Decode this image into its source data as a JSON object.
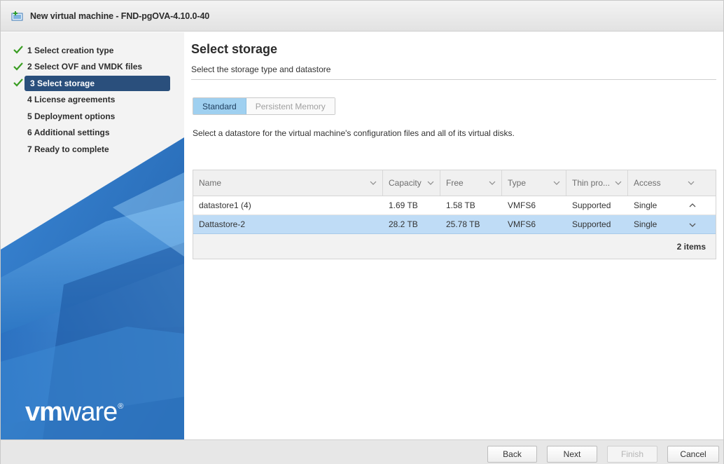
{
  "window": {
    "title": "New virtual machine - FND-pgOVA-4.10.0-40",
    "title_icon": "new-vm-icon"
  },
  "wizard": {
    "steps": [
      {
        "label": "1 Select creation type",
        "done": true
      },
      {
        "label": "2 Select OVF and VMDK files",
        "done": true
      },
      {
        "label": "3 Select storage",
        "done": true,
        "active": true
      },
      {
        "label": "4 License agreements",
        "done": false
      },
      {
        "label": "5 Deployment options",
        "done": false
      },
      {
        "label": "6 Additional settings",
        "done": false
      },
      {
        "label": "7 Ready to complete",
        "done": false
      }
    ],
    "check_color": "#3a9d23",
    "active_color": "#2a4f7c"
  },
  "brand": {
    "logo_bold": "vm",
    "logo_rest": "ware",
    "logo_mark": "®"
  },
  "page": {
    "title": "Select storage",
    "subtitle": "Select the storage type and datastore",
    "tabs": [
      {
        "label": "Standard",
        "selected": true
      },
      {
        "label": "Persistent Memory",
        "selected": false
      }
    ],
    "instruction": "Select a datastore for the virtual machine's configuration files and all of its virtual disks."
  },
  "datastores": {
    "columns": [
      "Name",
      "Capacity",
      "Free",
      "Type",
      "Thin pro...",
      "Access"
    ],
    "rows": [
      {
        "name": "datastore1 (4)",
        "capacity": "1.69 TB",
        "free": "1.58 TB",
        "type": "VMFS6",
        "thin": "Supported",
        "access": "Single",
        "selected": false
      },
      {
        "name": "Dattastore-2",
        "capacity": "28.2 TB",
        "free": "25.78 TB",
        "type": "VMFS6",
        "thin": "Supported",
        "access": "Single",
        "selected": true
      }
    ],
    "item_count": "2 items",
    "selected_row_color": "#bfdcf6"
  },
  "buttons": {
    "back": "Back",
    "next": "Next",
    "finish": "Finish",
    "cancel": "Cancel"
  }
}
